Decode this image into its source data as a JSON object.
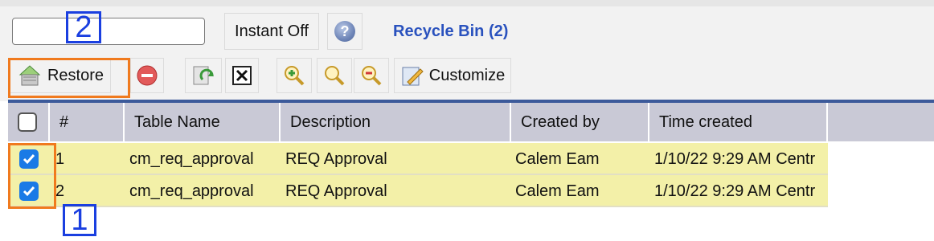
{
  "search": {
    "value": "",
    "placeholder": ""
  },
  "instant_label": "Instant Off",
  "help_symbol": "?",
  "view_title": "Recycle Bin (2)",
  "toolbar": {
    "restore_label": "Restore",
    "customize_label": "Customize"
  },
  "grid": {
    "columns": [
      "#",
      "Table Name",
      "Description",
      "Created by",
      "Time created"
    ],
    "rows": [
      {
        "checked": true,
        "num": "1",
        "table_name": "cm_req_approval",
        "description": "REQ Approval",
        "created_by": "Calem Eam",
        "time_created": "1/10/22 9:29 AM Centr"
      },
      {
        "checked": true,
        "num": "2",
        "table_name": "cm_req_approval",
        "description": "REQ Approval",
        "created_by": "Calem Eam",
        "time_created": "1/10/22 9:29 AM Centr"
      }
    ]
  },
  "annotations": {
    "label_1": "1",
    "label_2": "2"
  },
  "colors": {
    "title_blue": "#2a52be",
    "header_bg": "#c9c9d6",
    "row_highlight": "#f3f0a8",
    "annotation_orange": "#f07a1e",
    "annotation_blue": "#1a3fe0",
    "checkbox_blue": "#1a7ae6"
  }
}
